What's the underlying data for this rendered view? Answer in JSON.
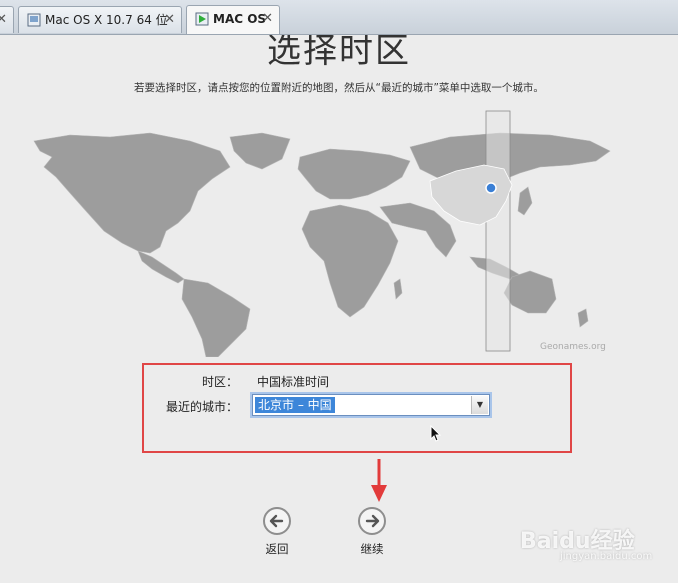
{
  "tabs": [
    {
      "label": "",
      "active": false
    },
    {
      "label": "Mac OS X 10.7 64 位",
      "active": false
    },
    {
      "label": "MAC OS",
      "active": true
    }
  ],
  "screen": {
    "title": "选择时区",
    "subtitle": "若要选择时区，请点按您的位置附近的地图，然后从“最近的城市”菜单中选取一个城市。",
    "map_credit": "Geonames.org"
  },
  "form": {
    "timezone_label": "时区：",
    "timezone_value": "中国标准时间",
    "city_label": "最近的城市：",
    "city_value": "北京市 – 中国"
  },
  "buttons": {
    "back_label": "返回",
    "continue_label": "继续"
  },
  "watermark": {
    "text": "Baidu经验",
    "sub": "jingyan.baidu.com"
  },
  "colors": {
    "highlight_frame": "#e04646",
    "land": "#9d9d9d",
    "selected_region": "#d7d7d7",
    "selection_blue": "#3d86d9"
  }
}
